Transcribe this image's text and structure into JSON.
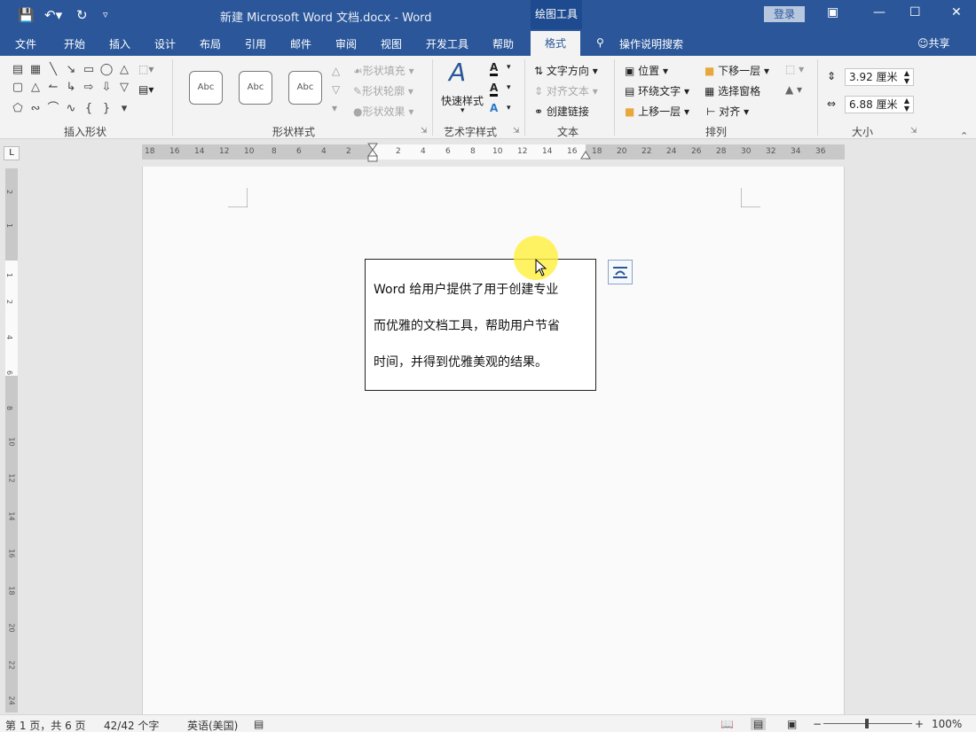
{
  "titlebar": {
    "title": "新建 Microsoft Word 文档.docx  -  Word",
    "context_tab": "绘图工具",
    "login": "登录"
  },
  "tabs": [
    "文件",
    "开始",
    "插入",
    "设计",
    "布局",
    "引用",
    "邮件",
    "审阅",
    "视图",
    "开发工具",
    "帮助",
    "格式"
  ],
  "tell_me": "操作说明搜索",
  "share": "共享",
  "ribbon": {
    "insert_shapes": {
      "label": "插入形状"
    },
    "shape_styles": {
      "label": "形状样式",
      "style_sample": "Abc",
      "fill": "形状填充",
      "outline": "形状轮廓",
      "effect": "形状效果"
    },
    "wordart": {
      "label": "艺术字样式",
      "quick_styles": "快速样式"
    },
    "text": {
      "label": "文本",
      "direction": "文字方向",
      "align": "对齐文本",
      "link": "创建链接"
    },
    "arrange": {
      "label": "排列",
      "position": "位置",
      "wrap": "环绕文字",
      "bring_forward": "上移一层",
      "send_backward": "下移一层",
      "selection_pane": "选择窗格",
      "align": "对齐"
    },
    "size": {
      "label": "大小",
      "height": "3.92 厘米",
      "width": "6.88 厘米"
    }
  },
  "ruler": {
    "h_ticks": [
      "18",
      "16",
      "14",
      "12",
      "10",
      "8",
      "6",
      "4",
      "2",
      "2",
      "4",
      "6",
      "8",
      "10",
      "12",
      "14",
      "16",
      "18",
      "20",
      "22",
      "24",
      "26",
      "28",
      "30",
      "32",
      "34",
      "36"
    ],
    "v_ticks": [
      "2",
      "1",
      "1",
      "2",
      "4",
      "6",
      "8",
      "10",
      "12",
      "14",
      "16",
      "18",
      "20",
      "22",
      "24"
    ],
    "corner": "L"
  },
  "document": {
    "lines": [
      "Word 给用户提供了用于创建专业",
      "而优雅的文档工具，帮助用户节省",
      "时间，并得到优雅美观的结果。"
    ]
  },
  "statusbar": {
    "page": "第 1 页，共 6 页",
    "words": "42/42 个字",
    "language": "英语(美国)",
    "zoom": "100%"
  }
}
